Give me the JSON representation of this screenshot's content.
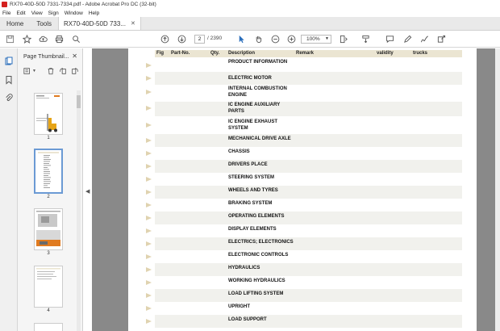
{
  "window": {
    "title": "RX70-40D-50D 7331-7334.pdf - Adobe Acrobat Pro DC (32-bit)"
  },
  "menu": [
    "File",
    "Edit",
    "View",
    "Sign",
    "Window",
    "Help"
  ],
  "tabs": {
    "home": "Home",
    "tools": "Tools",
    "document": "RX70-40D-50D 733..."
  },
  "toolbar": {
    "page_current": "2",
    "page_total": "/ 2390",
    "zoom": "100%"
  },
  "panel": {
    "title": "Page Thumbnail...",
    "thumbnails": [
      {
        "label": "1"
      },
      {
        "label": "2"
      },
      {
        "label": "3"
      },
      {
        "label": "4"
      }
    ]
  },
  "table": {
    "headers": {
      "fig": "Fig",
      "part_no": "Part-No.",
      "qty": "Qty.",
      "description": "Description",
      "remark": "Remark",
      "validity": "validity",
      "trucks": "trucks"
    },
    "rows": [
      "PRODUCT INFORMATION",
      "ELECTRIC MOTOR",
      "INTERNAL COMBUSTION ENGINE",
      "IC ENGINE AUXILIARY PARTS",
      "IC ENGINE EXHAUST SYSTEM",
      "MECHANICAL DRIVE AXLE",
      "CHASSIS",
      "DRIVERS PLACE",
      "STEERING SYSTEM",
      "WHEELS AND TYRES",
      "BRAKING SYSTEM",
      "OPERATING ELEMENTS",
      "DISPLAY ELEMENTS",
      "ELECTRICS; ELECTRONICS",
      "ELECTRONIC CONTROLS",
      "HYDRAULICS",
      "WORKING HYDRAULICS",
      "LOAD LIFTING SYSTEM",
      "UPRIGHT",
      "LOAD SUPPORT"
    ]
  },
  "colors": {
    "header_bg": "#ebe5d2",
    "doc_bg": "#898989",
    "thumb_selected": "#6b9ad4",
    "arrow": "#e0d3b0"
  }
}
